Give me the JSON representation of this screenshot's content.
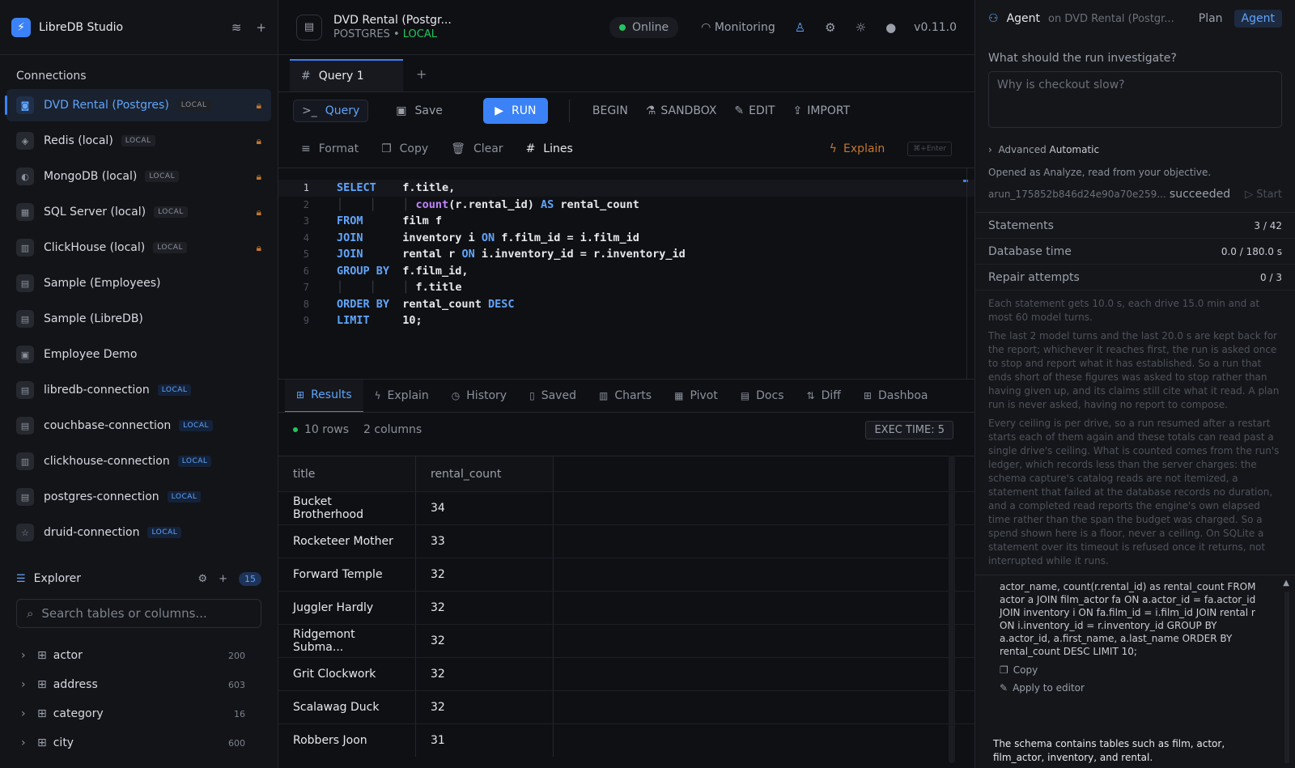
{
  "app": {
    "name": "LibreDB Studio"
  },
  "sidebar": {
    "connections_title": "Connections",
    "connections": [
      {
        "name": "DVD Rental (Postgres)",
        "badge": "LOCAL",
        "locked": true,
        "active": true
      },
      {
        "name": "Redis (local)",
        "badge": "LOCAL",
        "locked": true
      },
      {
        "name": "MongoDB (local)",
        "badge": "LOCAL",
        "locked": true
      },
      {
        "name": "SQL Server (local)",
        "badge": "LOCAL",
        "locked": true
      },
      {
        "name": "ClickHouse (local)",
        "badge": "LOCAL",
        "locked": true
      },
      {
        "name": "Sample (Employees)",
        "badge": ""
      },
      {
        "name": "Sample (LibreDB)",
        "badge": ""
      },
      {
        "name": "Employee Demo",
        "badge": ""
      },
      {
        "name": "libredb-connection",
        "badge": "LOCAL"
      },
      {
        "name": "couchbase-connection",
        "badge": "LOCAL"
      },
      {
        "name": "clickhouse-connection",
        "badge": "LOCAL"
      },
      {
        "name": "postgres-connection",
        "badge": "LOCAL"
      },
      {
        "name": "druid-connection",
        "badge": "LOCAL"
      }
    ],
    "explorer": {
      "title": "Explorer",
      "count": "15",
      "search_placeholder": "Search tables or columns...",
      "tables": [
        {
          "name": "actor",
          "count": "200"
        },
        {
          "name": "address",
          "count": "603"
        },
        {
          "name": "category",
          "count": "16"
        },
        {
          "name": "city",
          "count": "600"
        }
      ]
    }
  },
  "topbar": {
    "db_title": "DVD Rental (Postgr...",
    "db_engine": "POSTGRES",
    "db_scope": "LOCAL",
    "status": "Online",
    "monitoring": "Monitoring",
    "version": "v0.11.0"
  },
  "tabs": {
    "query_tab": "Query 1"
  },
  "toolbar": {
    "query": "Query",
    "save": "Save",
    "run": "RUN",
    "begin": "BEGIN",
    "sandbox": "SANDBOX",
    "edit": "EDIT",
    "import": "IMPORT",
    "format": "Format",
    "copy": "Copy",
    "clear": "Clear",
    "lines": "Lines",
    "explain": "Explain",
    "shortcut": "⌘+Enter"
  },
  "editor": {
    "lines": [
      "1",
      "2",
      "3",
      "4",
      "5",
      "6",
      "7",
      "8",
      "9"
    ]
  },
  "results": {
    "tabs": [
      "Results",
      "Explain",
      "History",
      "Saved",
      "Charts",
      "Pivot",
      "Docs",
      "Diff",
      "Dashboa"
    ],
    "rows_label": "10 rows",
    "cols_label": "2 columns",
    "exec_time": "EXEC TIME: 5",
    "columns": [
      "title",
      "rental_count"
    ],
    "rows": [
      [
        "Bucket Brotherhood",
        "34"
      ],
      [
        "Rocketeer Mother",
        "33"
      ],
      [
        "Forward Temple",
        "32"
      ],
      [
        "Juggler Hardly",
        "32"
      ],
      [
        "Ridgemont Subma...",
        "32"
      ],
      [
        "Grit Clockwork",
        "32"
      ],
      [
        "Scalawag Duck",
        "32"
      ],
      [
        "Robbers Joon",
        "31"
      ]
    ]
  },
  "agent": {
    "title": "Agent",
    "subtitle": "on DVD Rental (Postgr...",
    "plan": "Plan",
    "agent_btn": "Agent",
    "question": "What should the run investigate?",
    "placeholder": "Why is checkout slow?",
    "advanced_label": "Advanced",
    "advanced_value": "Automatic",
    "opened": "Opened as Analyze, read from your objective.",
    "run_id": "arun_175852b846d24e90a70e259...",
    "run_status": "succeeded",
    "start": "Start",
    "stats": [
      {
        "k": "Statements",
        "v": "3 / 42"
      },
      {
        "k": "Database time",
        "v": "0.0 / 180.0 s"
      },
      {
        "k": "Repair attempts",
        "v": "0 / 3"
      }
    ],
    "note1": "Each statement gets 10.0 s, each drive 15.0 min and at most 60 model turns.",
    "note2": "The last 2 model turns and the last 20.0 s are kept back for the report; whichever it reaches first, the run is asked once to stop and report what it has established. So a run that ends short of these figures was asked to stop rather than having given up, and its claims still cite what it read. A plan run is never asked, having no report to compose.",
    "note3": "Every ceiling is per drive, so a run resumed after a restart starts each of them again and these totals can read past a single drive's ceiling. What is counted comes from the run's ledger, which records less than the server charges: the schema capture's catalog reads are not itemized, a statement that failed at the database records no duration, and a completed read reports the engine's own elapsed time rather than the span the budget was charged. So a spend shown here is a floor, never a ceiling. On SQLite a statement over its timeout is refused once it returns, not interrupted while it runs.",
    "sql_snippet": "actor_name, count(r.rental_id) as rental_count FROM actor a JOIN film_actor fa ON a.actor_id = fa.actor_id JOIN inventory i ON fa.film_id = i.film_id JOIN rental r ON i.inventory_id = r.inventory_id GROUP BY a.actor_id, a.first_name, a.last_name ORDER BY rental_count DESC LIMIT 10;",
    "copy": "Copy",
    "apply": "Apply to editor",
    "summary": "The schema contains tables such as film, actor, film_actor, inventory, and rental."
  }
}
